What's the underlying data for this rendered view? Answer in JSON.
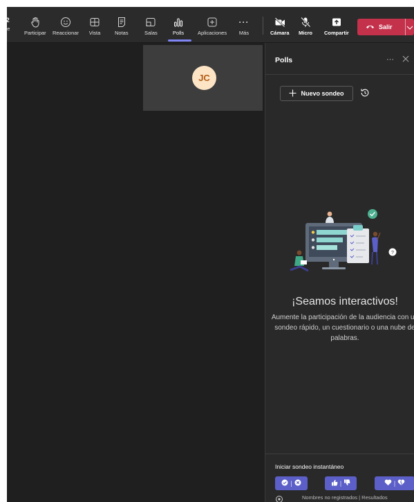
{
  "toolbar": {
    "partial_count": "2",
    "partial_label": "te",
    "items": [
      {
        "label": "Participar",
        "icon": "raise-hand-icon"
      },
      {
        "label": "Reaccionar",
        "icon": "smiley-icon"
      },
      {
        "label": "Vista",
        "icon": "grid-icon"
      },
      {
        "label": "Notas",
        "icon": "notes-icon"
      },
      {
        "label": "Salas",
        "icon": "rooms-icon"
      },
      {
        "label": "Polls",
        "icon": "polls-icon",
        "active": true
      },
      {
        "label": "Aplicaciones",
        "icon": "apps-icon"
      },
      {
        "label": "Más",
        "icon": "more-icon"
      }
    ],
    "devices": [
      {
        "label": "Cámara",
        "icon": "camera-off-icon"
      },
      {
        "label": "Micro",
        "icon": "mic-off-icon"
      },
      {
        "label": "Compartir",
        "icon": "share-icon"
      }
    ],
    "leave_label": "Salir"
  },
  "stage": {
    "avatar_initials": "JC"
  },
  "panel": {
    "title": "Polls",
    "new_poll_label": "Nuevo sondeo",
    "empty_title": "¡Seamos interactivos!",
    "empty_description": "Aumente la participación de la audiencia con un sondeo rápido, un cuestionario o una nube de palabras.",
    "quick_poll_label": "Iniciar sondeo instantáneo",
    "footer_text": "Nombres no registrados | Resultados"
  },
  "colors": {
    "accent": "#5b5fc7",
    "leave": "#c4314b",
    "background": "#1f1f1f",
    "panel": "#292929"
  }
}
